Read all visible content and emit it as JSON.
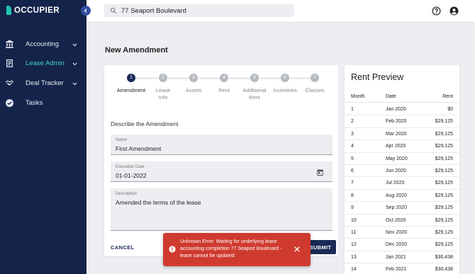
{
  "app": {
    "logo_text": "OCCUPIER",
    "accent": "#3fd6c6",
    "sidebar_bg": "#14234a",
    "primary": "#1a2a55",
    "error": "#cf3a2f"
  },
  "sidebar": {
    "items": [
      {
        "label": "Accounting",
        "icon": "bank-icon",
        "expandable": true,
        "active": false
      },
      {
        "label": "Lease Admin",
        "icon": "document-icon",
        "expandable": true,
        "active": true
      },
      {
        "label": "Deal Tracker",
        "icon": "handshake-icon",
        "expandable": true,
        "active": false
      },
      {
        "label": "Tasks",
        "icon": "check-circle-icon",
        "expandable": false,
        "active": false
      }
    ]
  },
  "topbar": {
    "search_value": "77 Seaport Boulevard",
    "icons": [
      "help-icon",
      "account-icon"
    ]
  },
  "page": {
    "title": "New Amendment"
  },
  "stepper": {
    "steps": [
      {
        "number": "1",
        "label": "Amendment",
        "active": true
      },
      {
        "number": "2",
        "label": "Lease Info",
        "active": false
      },
      {
        "number": "3",
        "label": "Assets",
        "active": false
      },
      {
        "number": "4",
        "label": "Rent",
        "active": false
      },
      {
        "number": "5",
        "label": "Additional Rent",
        "active": false
      },
      {
        "number": "6",
        "label": "Incentives",
        "active": false
      },
      {
        "number": "7",
        "label": "Clauses",
        "active": false
      }
    ]
  },
  "form": {
    "section_label": "Describe the Amendment",
    "name_label": "Name",
    "name_value": "First Amendment",
    "date_label": "Execution Date",
    "date_value": "01-01-2022",
    "description_label": "Description",
    "description_value": "Amended the terms of the lease",
    "cancel_label": "CANCEL",
    "submit_label": "SUBMIT"
  },
  "toast": {
    "message": "Unknown Error: Waiting for underlying lease accounting completion 77 Seaport Boulevard - lease cannot be updated"
  },
  "rent_preview": {
    "title": "Rent Preview",
    "columns": [
      "Month",
      "Date",
      "Rent"
    ],
    "rows": [
      [
        "1",
        "Jan 2020",
        "$0"
      ],
      [
        "2",
        "Feb 2020",
        "$29,125"
      ],
      [
        "3",
        "Mar 2020",
        "$29,125"
      ],
      [
        "4",
        "Apr 2020",
        "$29,125"
      ],
      [
        "5",
        "May 2020",
        "$29,125"
      ],
      [
        "6",
        "Jun 2020",
        "$29,125"
      ],
      [
        "7",
        "Jul 2020",
        "$29,125"
      ],
      [
        "8",
        "Aug 2020",
        "$29,125"
      ],
      [
        "9",
        "Sep 2020",
        "$29,125"
      ],
      [
        "10",
        "Oct 2020",
        "$29,125"
      ],
      [
        "11",
        "Nov 2020",
        "$29,125"
      ],
      [
        "12",
        "Dec 2020",
        "$29,125"
      ],
      [
        "13",
        "Jan 2021",
        "$30,438"
      ],
      [
        "14",
        "Feb 2021",
        "$30,438"
      ]
    ]
  }
}
